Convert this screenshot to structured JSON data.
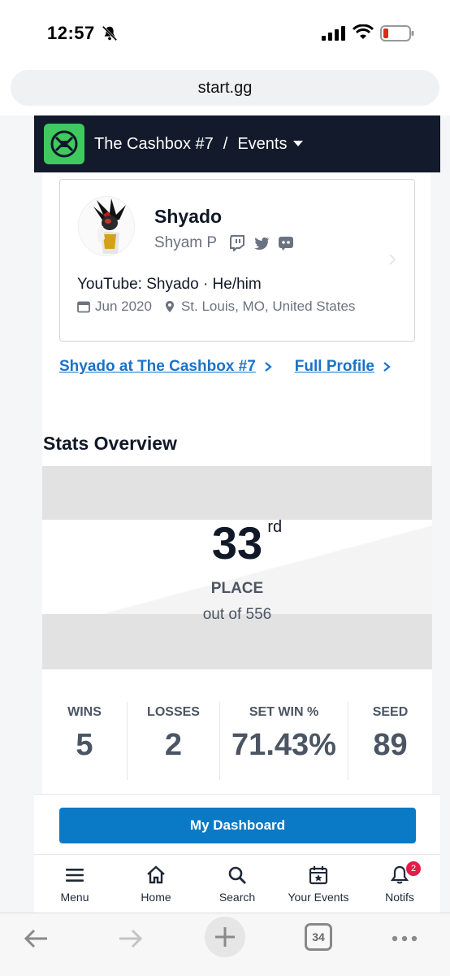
{
  "status_bar": {
    "time": "12:57"
  },
  "browser": {
    "url": "start.gg",
    "tab_count": "34"
  },
  "header": {
    "tournament": "The Cashbox #7",
    "separator": "/",
    "section": "Events"
  },
  "profile": {
    "gamer_tag": "Shyado",
    "real_name": "Shyam P",
    "bio": "YouTube: Shyado · He/him",
    "joined": "Jun 2020",
    "location": "St. Louis, MO, United States",
    "socials": [
      "twitch-icon",
      "twitter-icon",
      "discord-icon"
    ]
  },
  "links": {
    "event_link": "Shyado at The Cashbox #7",
    "full_profile": "Full Profile"
  },
  "stats": {
    "heading": "Stats Overview",
    "place": "33",
    "place_suffix": "rd",
    "place_label": "PLACE",
    "out_of": "out of 556",
    "items": [
      {
        "label": "WINS",
        "value": "5"
      },
      {
        "label": "LOSSES",
        "value": "2"
      },
      {
        "label": "SET WIN %",
        "value": "71.43%"
      },
      {
        "label": "SEED",
        "value": "89"
      }
    ]
  },
  "dashboard_button": "My Dashboard",
  "bottom_nav": [
    {
      "label": "Menu",
      "icon": "menu-icon"
    },
    {
      "label": "Home",
      "icon": "home-icon"
    },
    {
      "label": "Search",
      "icon": "search-icon"
    },
    {
      "label": "Your Events",
      "icon": "calendar-star-icon"
    },
    {
      "label": "Notifs",
      "icon": "bell-icon",
      "badge": "2"
    }
  ],
  "colors": {
    "header_bg": "#121a2b",
    "logo_green": "#3fc95e",
    "link_blue": "#1a73c8",
    "button_blue": "#0a7ac6",
    "badge_red": "#e11d48"
  }
}
